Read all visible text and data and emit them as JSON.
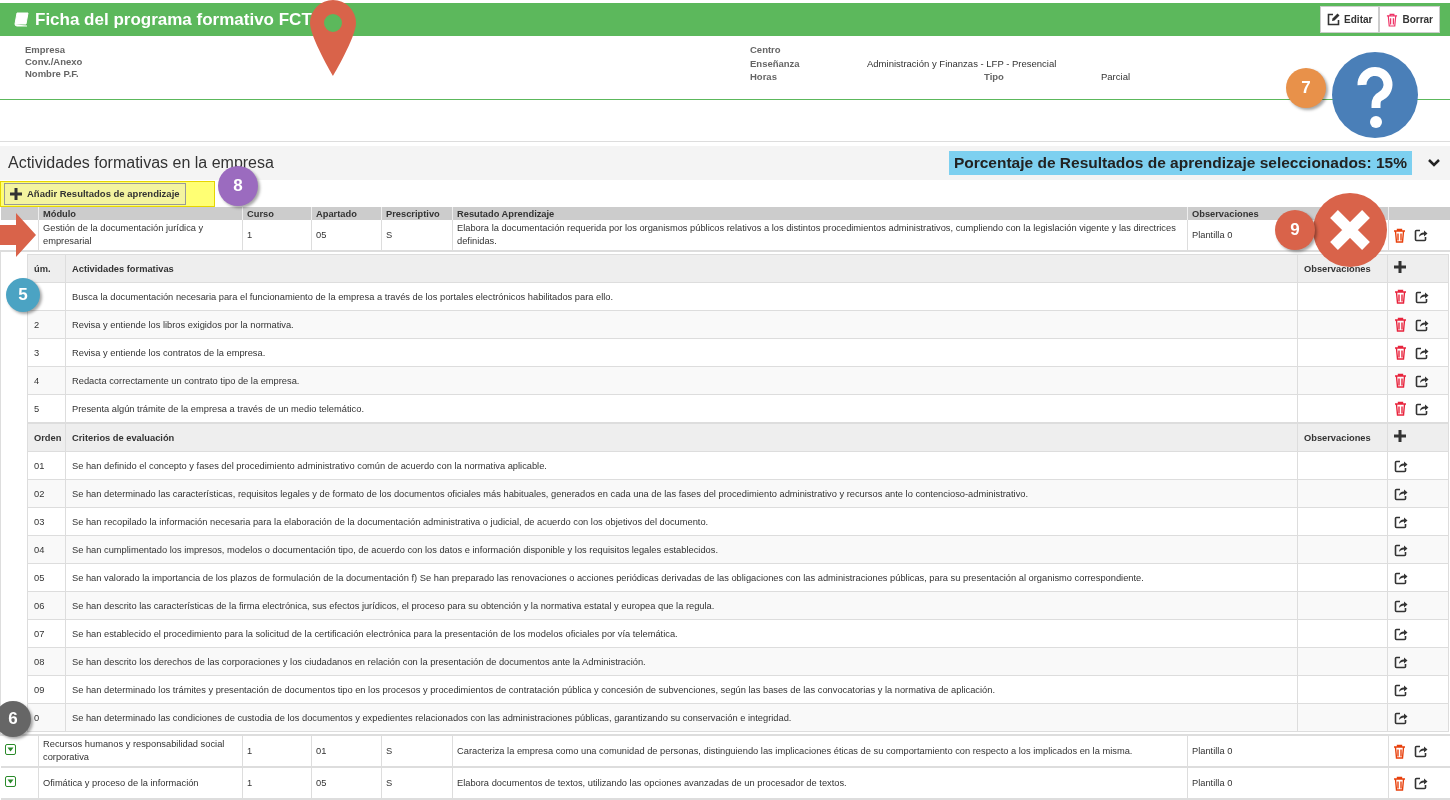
{
  "header": {
    "title": "Ficha del programa formativo FCT",
    "buttons": [
      {
        "label": "Editar",
        "kind": "edit"
      },
      {
        "label": "Borrar",
        "kind": "delete"
      }
    ]
  },
  "info_left": [
    {
      "label": "Empresa"
    },
    {
      "label": "Conv./Anexo"
    },
    {
      "label": "Nombre P.F."
    }
  ],
  "info_right": {
    "centro": "Centro",
    "ensenanza": "Enseñanza",
    "ensenanza_value": "Administración y Finanzas - LFP - Presencial",
    "horas": "Horas",
    "tipo": "Tipo",
    "tipo_value": "Parcial"
  },
  "section": {
    "title": "Actividades formativas en la empresa",
    "percentage": "Porcentaje de Resultados de aprendizaje seleccionados: 15%",
    "add_button": "Añadir Resultados de aprendizaje"
  },
  "table": {
    "columns": [
      "Módulo",
      "Curso",
      "Apartado",
      "Prescriptivo",
      "Resutado Aprendizaje",
      "Observaciones"
    ],
    "rows": [
      {
        "modulo": "Gestión de la documentación jurídica y empresarial",
        "curso": "1",
        "apartado": "05",
        "prescriptivo": "S",
        "resultado": "Elabora la documentación requerida por los organismos públicos relativos a los distintos procedimientos administrativos, cumpliendo con la legislación vigente y las directrices definidas.",
        "observaciones": "Plantilla 0",
        "expanded": true,
        "activities": {
          "columns": [
            "úm.",
            "Actividades formativas",
            "Observaciones"
          ],
          "rows": [
            {
              "text": "Busca la documentación necesaria para el funcionamiento de la empresa a través de los portales electrónicos habilitados para ello."
            },
            {
              "num": "2",
              "text": "Revisa y entiende los libros exigidos por la normativa."
            },
            {
              "num": "3",
              "text": "Revisa y entiende los contratos de la empresa."
            },
            {
              "num": "4",
              "text": "Redacta correctamente un contrato tipo de la empresa."
            },
            {
              "num": "5",
              "text": "Presenta algún trámite de la empresa a través de un medio telemático."
            }
          ]
        },
        "criteria": {
          "columns": [
            "Orden",
            "Criterios de evaluación",
            "Observaciones"
          ],
          "rows": [
            {
              "num": "01",
              "text": "Se han definido el concepto y fases del procedimiento administrativo común de acuerdo con la normativa aplicable."
            },
            {
              "num": "02",
              "text": "Se han determinado las características, requisitos legales y de formato de los documentos oficiales más habituales, generados en cada una de las fases del procedimiento administrativo y recursos ante lo contencioso-administrativo."
            },
            {
              "num": "03",
              "text": "Se han recopilado la información necesaria para la elaboración de la documentación administrativa o judicial, de acuerdo con los objetivos del documento."
            },
            {
              "num": "04",
              "text": "Se han cumplimentado los impresos, modelos o documentación tipo, de acuerdo con los datos e información disponible y los requisitos legales establecidos."
            },
            {
              "num": "05",
              "text": "Se han valorado la importancia de los plazos de formulación de la documentación f) Se han preparado las renovaciones o acciones periódicas derivadas de las obligaciones con las administraciones públicas, para su presentación al organismo correspondiente."
            },
            {
              "num": "06",
              "text": "Se han descrito las características de la firma electrónica, sus efectos jurídicos, el proceso para su obtención y la normativa estatal y europea que la regula."
            },
            {
              "num": "07",
              "text": "Se han establecido el procedimiento para la solicitud de la certificación electrónica para la presentación de los modelos oficiales por vía telemática."
            },
            {
              "num": "08",
              "text": "Se han descrito los derechos de las corporaciones y los ciudadanos en relación con la presentación de documentos ante la Administración."
            },
            {
              "num": "09",
              "text": "Se han determinado los trámites y presentación de documentos tipo en los procesos y procedimientos de contratación pública y concesión de subvenciones, según las bases de las convocatorias y la normativa de aplicación."
            },
            {
              "num": "0",
              "text": "Se han determinado las condiciones de custodia de los documentos y expedientes relacionados con las administraciones públicas, garantizando su conservación e integridad."
            }
          ]
        }
      },
      {
        "modulo": "Recursos humanos y responsabilidad social corporativa",
        "curso": "1",
        "apartado": "01",
        "prescriptivo": "S",
        "resultado": "Caracteriza la empresa como una comunidad de personas, distinguiendo las implicaciones éticas de su comportamiento con respecto a los implicados en la misma.",
        "observaciones": "Plantilla 0",
        "expanded": false
      },
      {
        "modulo": "Ofimática y proceso de la información",
        "curso": "1",
        "apartado": "05",
        "prescriptivo": "S",
        "resultado": "Elabora documentos de textos, utilizando las opciones avanzadas de un procesador de textos.",
        "observaciones": "Plantilla 0",
        "expanded": false
      }
    ]
  },
  "annotations": [
    {
      "label": "7",
      "color": "#e8914a"
    },
    {
      "label": "8",
      "color": "#9b6bbf"
    },
    {
      "label": "9",
      "color": "#d9634a"
    },
    {
      "label": "5",
      "color": "#4ba3c3"
    },
    {
      "label": "6",
      "color": "#666666"
    }
  ]
}
